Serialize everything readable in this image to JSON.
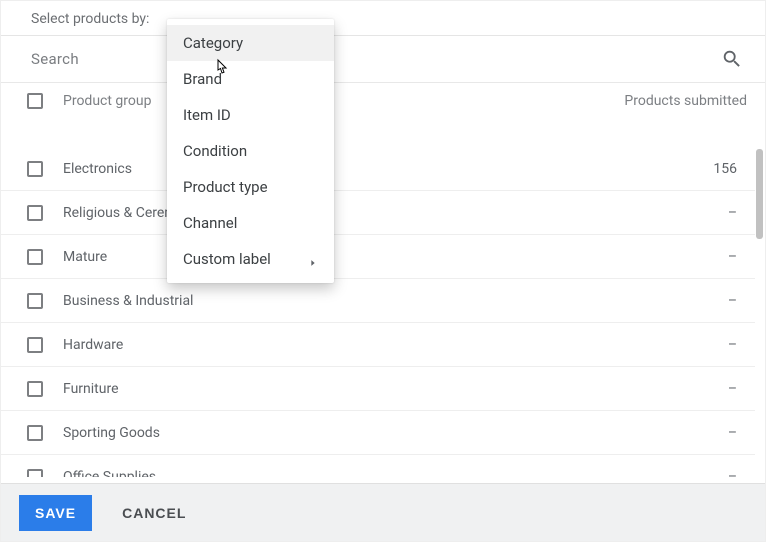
{
  "header": {
    "select_by_label": "Select products by:"
  },
  "search": {
    "placeholder": "Search"
  },
  "table": {
    "columns": {
      "group": "Product group",
      "submitted": "Products submitted"
    },
    "rows": [
      {
        "name": "Electronics",
        "submitted": "156"
      },
      {
        "name": "Religious & Ceremonial",
        "submitted": "–"
      },
      {
        "name": "Mature",
        "submitted": "–"
      },
      {
        "name": "Business & Industrial",
        "submitted": "–"
      },
      {
        "name": "Hardware",
        "submitted": "–"
      },
      {
        "name": "Furniture",
        "submitted": "–"
      },
      {
        "name": "Sporting Goods",
        "submitted": "–"
      },
      {
        "name": "Office Supplies",
        "submitted": "–"
      }
    ]
  },
  "dropdown": {
    "items": [
      {
        "label": "Category",
        "hover": true,
        "submenu": false
      },
      {
        "label": "Brand",
        "hover": false,
        "submenu": false
      },
      {
        "label": "Item ID",
        "hover": false,
        "submenu": false
      },
      {
        "label": "Condition",
        "hover": false,
        "submenu": false
      },
      {
        "label": "Product type",
        "hover": false,
        "submenu": false
      },
      {
        "label": "Channel",
        "hover": false,
        "submenu": false
      },
      {
        "label": "Custom label",
        "hover": false,
        "submenu": true
      }
    ]
  },
  "footer": {
    "save": "SAVE",
    "cancel": "CANCEL"
  }
}
